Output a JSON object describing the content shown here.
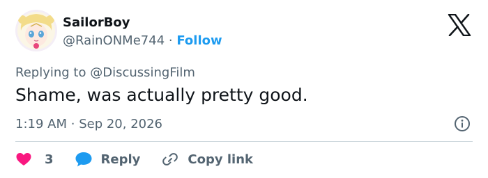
{
  "tweet": {
    "display_name": "SailorBoy",
    "handle": "@RainONMe744",
    "separator": "·",
    "follow_label": "Follow",
    "replying_prefix": "Replying to",
    "replying_to": "@DiscussingFilm",
    "text": "Shame, was actually pretty good.",
    "time": "1:19 AM",
    "date": "Sep 20, 2026"
  },
  "actions": {
    "likes_count": "3",
    "reply_label": "Reply",
    "copy_link_label": "Copy link"
  },
  "icons": {
    "brand": "x-logo-icon",
    "info": "info-icon",
    "like": "heart-icon",
    "reply": "speech-bubble-icon",
    "copy_link": "link-icon"
  },
  "colors": {
    "text_primary": "#0f1419",
    "text_secondary": "#536471",
    "accent": "#1d9bf0",
    "heart": "#f91880",
    "divider": "#cfd9de"
  }
}
